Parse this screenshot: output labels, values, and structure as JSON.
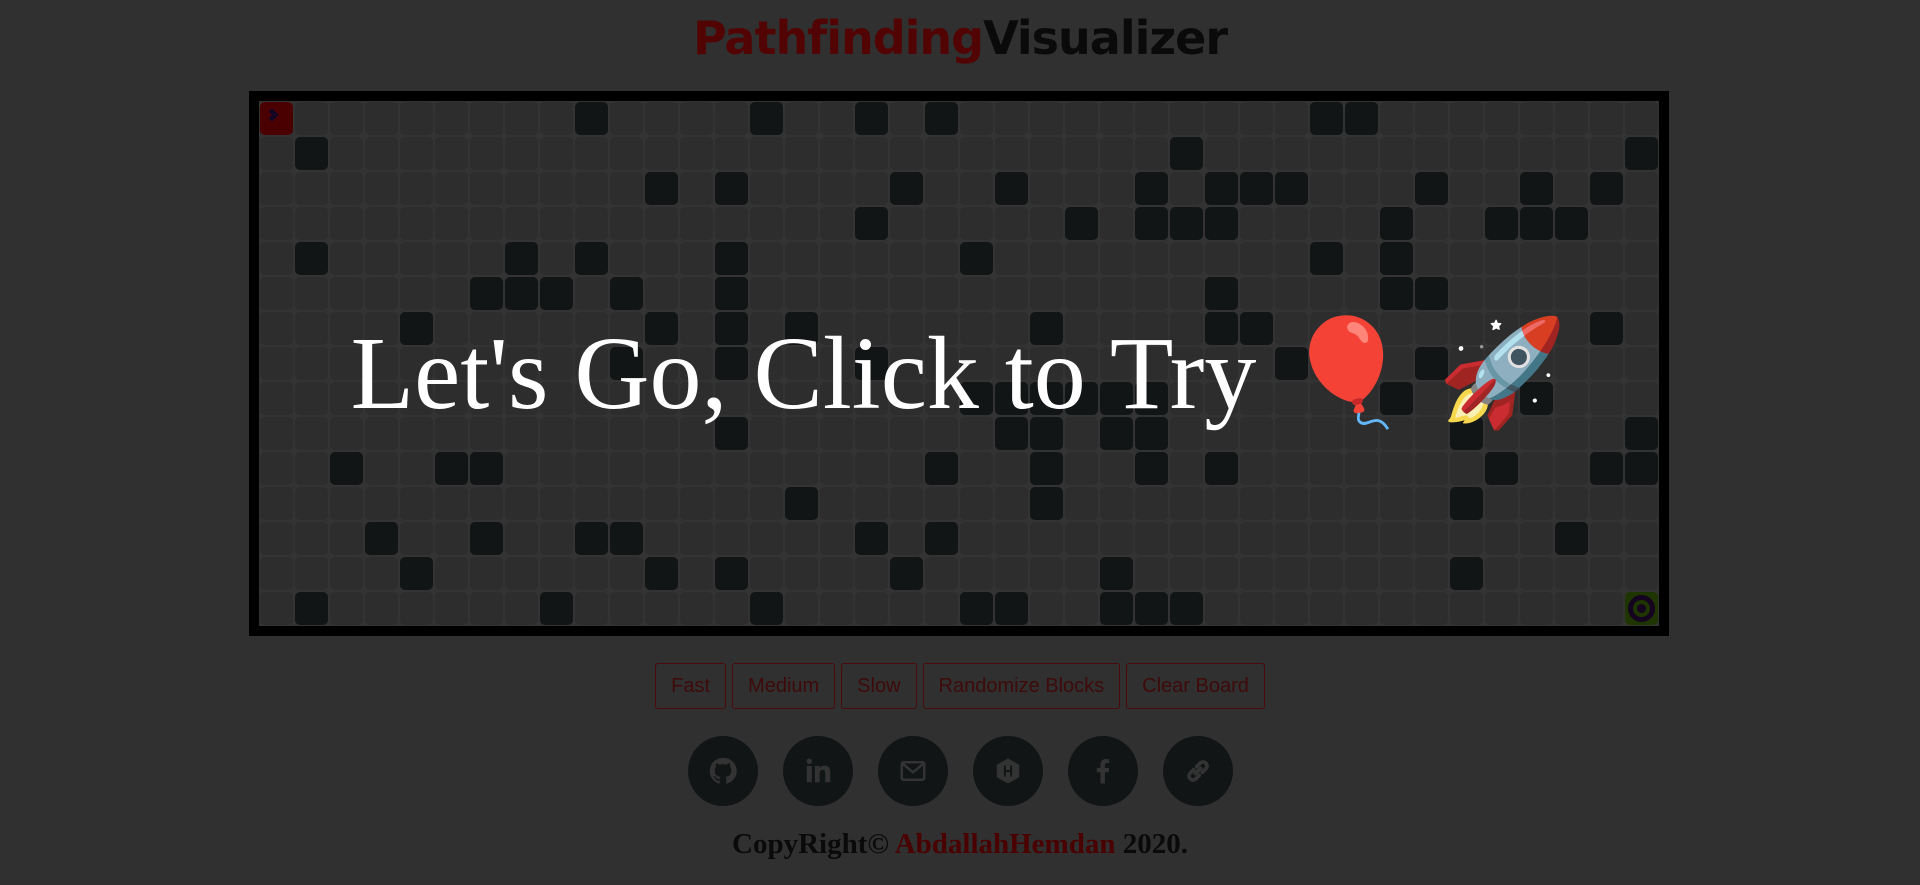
{
  "title": {
    "part1": "Pathfinding",
    "part2": "Visualizer"
  },
  "board": {
    "rows": 15,
    "cols": 40,
    "start": {
      "row": 0,
      "col": 0,
      "icon": "chevron-right-icon"
    },
    "end": {
      "row": 14,
      "col": 39,
      "icon": "target-icon"
    },
    "walls": [
      [
        9,
        14,
        17,
        19,
        30,
        31
      ],
      [
        1,
        26,
        39
      ],
      [
        11,
        13,
        18,
        21,
        25,
        27,
        28,
        29,
        33,
        36,
        38
      ],
      [
        17,
        23,
        25,
        26,
        27,
        32,
        35,
        36,
        37
      ],
      [
        1,
        7,
        9,
        13,
        20,
        30,
        32
      ],
      [
        6,
        7,
        8,
        10,
        13,
        27,
        32,
        33
      ],
      [
        4,
        11,
        13,
        15,
        22,
        27,
        28,
        38
      ],
      [
        10,
        13,
        17,
        29,
        33
      ],
      [
        20,
        21,
        22,
        23,
        24,
        25,
        32,
        36
      ],
      [
        13,
        21,
        22,
        24,
        25,
        34,
        39
      ],
      [
        2,
        5,
        6,
        19,
        22,
        25,
        27,
        35,
        38,
        39
      ],
      [
        15,
        22,
        34
      ],
      [
        3,
        6,
        9,
        10,
        17,
        19,
        37
      ],
      [
        4,
        11,
        13,
        18,
        24,
        34
      ],
      [
        1,
        8,
        14,
        20,
        21,
        24,
        25,
        26
      ]
    ],
    "overlay_text": "Let's Go, Click to Try 🎈 🚀"
  },
  "buttons": {
    "fast": "Fast",
    "medium": "Medium",
    "slow": "Slow",
    "randomize": "Randomize Blocks",
    "clear": "Clear Board"
  },
  "socials": [
    {
      "name": "github-icon"
    },
    {
      "name": "linkedin-icon"
    },
    {
      "name": "email-icon"
    },
    {
      "name": "hackerrank-icon"
    },
    {
      "name": "facebook-icon"
    },
    {
      "name": "link-icon"
    }
  ],
  "footer": {
    "prefix": "CopyRight©",
    "author": "AbdallahHemdan",
    "year": "2020."
  },
  "colors": {
    "background": "#303030",
    "wall": "#111516",
    "cell": "#2d2d2d",
    "start": "#4a0000",
    "end": "#1f3500",
    "accent": "#520404"
  }
}
